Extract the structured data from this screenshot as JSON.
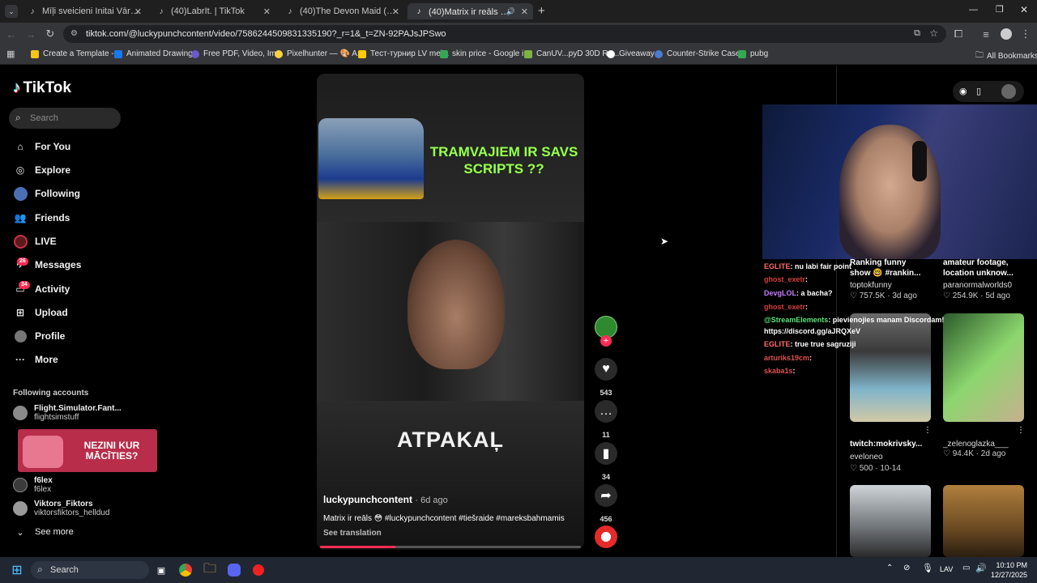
{
  "browser": {
    "tabs": [
      {
        "title": "Mīļi sveicieni Initai Vārda dienā",
        "active": false
      },
      {
        "title": "(40)LabrIt. | TikTok",
        "active": false
      },
      {
        "title": "(40)The Devon Maid (@the_de",
        "active": false
      },
      {
        "title": "(40)Matrix ir reāls 😳 #luck",
        "active": true
      }
    ],
    "url": "tiktok.com/@luckypunchcontent/video/7586244509831335190?_r=1&_t=ZN-92PAJsJPSwo",
    "bookmarks": [
      {
        "label": "Create a Template -...",
        "color": "#f5c518"
      },
      {
        "label": "Animated Drawings",
        "color": "#1877f2"
      },
      {
        "label": "Free PDF, Video, Im...",
        "color": "#6a5acd"
      },
      {
        "label": "Pixelhunter — 🎨 A...",
        "color": "#ffd23f"
      },
      {
        "label": "Тест-турнир LV mei...",
        "color": "#ffcc00"
      },
      {
        "label": "skin price - Google i...",
        "color": "#34a853"
      },
      {
        "label": "CanUV...pyD 30D Re...",
        "color": "#7cb342"
      },
      {
        "label": "Giveaway",
        "color": "#ffffff"
      },
      {
        "label": "Counter-Strike Case...",
        "color": "#4a7bd0"
      },
      {
        "label": "pubg",
        "color": "#34a853"
      }
    ],
    "all_bookmarks": "All Bookmarks"
  },
  "tiktok": {
    "logo": "TikTok",
    "search_placeholder": "Search",
    "nav": [
      {
        "label": "For You",
        "icon": "home-icon"
      },
      {
        "label": "Explore",
        "icon": "compass-icon"
      },
      {
        "label": "Following",
        "icon": "following-icon"
      },
      {
        "label": "Friends",
        "icon": "friends-icon"
      },
      {
        "label": "LIVE",
        "icon": "live-icon"
      },
      {
        "label": "Messages",
        "icon": "messages-icon",
        "badge": "26"
      },
      {
        "label": "Activity",
        "icon": "activity-icon",
        "badge": "34"
      },
      {
        "label": "Upload",
        "icon": "upload-icon"
      },
      {
        "label": "Profile",
        "icon": "profile-icon"
      },
      {
        "label": "More",
        "icon": "more-icon"
      }
    ],
    "following_title": "Following accounts",
    "accounts": [
      {
        "name": "Flight.Simulator.Fant...",
        "handle": "flightsimstuff"
      },
      {
        "name": "f6lex",
        "handle": "f6lex"
      },
      {
        "name": "Viktors_Fiktors",
        "handle": "viktorsfiktors_helldud"
      }
    ],
    "see_more": "See more",
    "ad_banner": "NEZINI KUR MĀCĪTIES?"
  },
  "video": {
    "headline": "TRAMVAJIEM IR SAVS SCRIPTS ??",
    "overlay_text": "ATPAKAĻ",
    "author": "luckypunchcontent",
    "age": "· 6d ago",
    "caption": "Matrix ir reāls 😳 #luckypunchcontent #tiešraide #mareksbahmamis",
    "see_translation": "See translation",
    "progress": 0.29
  },
  "actions": {
    "likes": "543",
    "comments": "11",
    "saves": "34",
    "shares": "456"
  },
  "right_grid": [
    {
      "title": "Ranking funny show 🤓 #rankin...",
      "user": "toptokfunny",
      "stats": "♡ 757.5K · 3d ago"
    },
    {
      "title": "amateur footage, location unknow...",
      "user": "paranormalworlds0",
      "stats": "♡ 254.9K · 5d ago"
    },
    {
      "title": "twitch:mokrivsky...",
      "user": "eveloneo",
      "stats": "♡ 500 · 10-14"
    },
    {
      "title": "_zelenoglazka___",
      "user": "",
      "stats": "♡ 94.4K · 2d ago"
    }
  ],
  "stream_chat": [
    {
      "user": "EGLITE",
      "msg": ": nu labi fair point",
      "color": "#ff6b6b"
    },
    {
      "user": "ghost_exetr",
      "msg": ":",
      "color": "#d63b3b"
    },
    {
      "user": "DevgLOL",
      "msg": ": a bacha?",
      "color": "#c77dff"
    },
    {
      "user": "ghost_exetr",
      "msg": ":",
      "color": "#d63b3b"
    },
    {
      "user": "@StreamElements",
      "msg": ": pievienojies manam Discordam!",
      "color": "#5be37a"
    },
    {
      "user": "",
      "msg": "https://discord.gg/aJRQXeV",
      "color": "#ffffff"
    },
    {
      "user": "EGLITE",
      "msg": ": true true sagruziji",
      "color": "#ff6b6b"
    },
    {
      "user": "arturiks19cm",
      "msg": ":",
      "color": "#e05050"
    },
    {
      "user": "skaba1s",
      "msg": ":",
      "color": "#e05050"
    }
  ],
  "taskbar": {
    "search": "Search",
    "lang": "LAV",
    "time": "10:10 PM",
    "date": "12/27/2025"
  }
}
